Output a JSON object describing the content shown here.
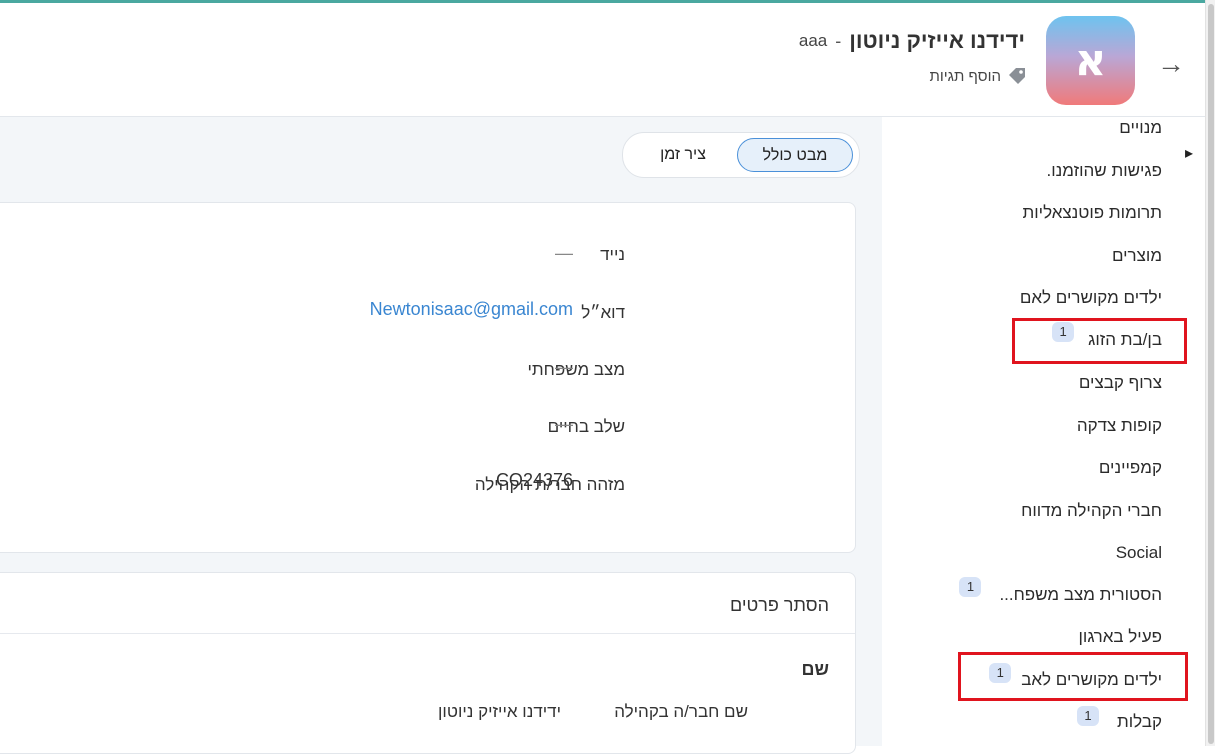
{
  "header": {
    "member_name": "ידידנו אייזיק ניוטון",
    "separator": "-",
    "member_code": "aaa",
    "avatar_letter": "א",
    "add_tags_label": "הוסף תגיות",
    "back_icon": "arrow-right-icon",
    "tag_icon": "tag-icon"
  },
  "view_toggle": {
    "overview_label": "מבט כולל",
    "timeline_label": "ציר זמן",
    "active": "overview"
  },
  "sidebar": {
    "items": [
      {
        "label": "מנויים",
        "badge": ""
      },
      {
        "label": "פגישות שהוזמנו.",
        "badge": ""
      },
      {
        "label": "תרומות פוטנצאליות",
        "badge": ""
      },
      {
        "label": "מוצרים",
        "badge": ""
      },
      {
        "label": "ילדים מקושרים לאם",
        "badge": ""
      },
      {
        "label": "בן/בת הזוג",
        "badge": "1"
      },
      {
        "label": "צרוף קבצים",
        "badge": ""
      },
      {
        "label": "קופות צדקה",
        "badge": ""
      },
      {
        "label": "קמפיינים",
        "badge": ""
      },
      {
        "label": "חברי הקהילה מדווח",
        "badge": ""
      },
      {
        "label": "Social",
        "badge": ""
      },
      {
        "label": "הסטורית מצב משפח...",
        "badge": "1"
      },
      {
        "label": "פעיל בארגון",
        "badge": ""
      },
      {
        "label": "ילדים מקושרים לאב",
        "badge": "1"
      },
      {
        "label": "קבלות",
        "badge": "1"
      }
    ]
  },
  "details_card": {
    "fields": [
      {
        "label": "נייד",
        "value": "—"
      },
      {
        "label": "דוא״ל",
        "value": "Newtonisaac@gmail.com"
      },
      {
        "label": "מצב משפחתי",
        "value": "—"
      },
      {
        "label": "שלב בחיים",
        "value": "—"
      },
      {
        "label": "מזהה חבר/ת הקהילה",
        "value": "CO24376"
      }
    ]
  },
  "name_card": {
    "hide_details_label": "הסתר פרטים",
    "section_label": "שם",
    "field_label": "שם חבר/ה בקהילה",
    "field_value": "ידידנו אייזיק ניוטון"
  },
  "colors": {
    "accent_line": "#4aa8a0",
    "highlight_box": "#e0141e",
    "link": "#3a86d1",
    "badge_bg": "#d7e3f7"
  }
}
